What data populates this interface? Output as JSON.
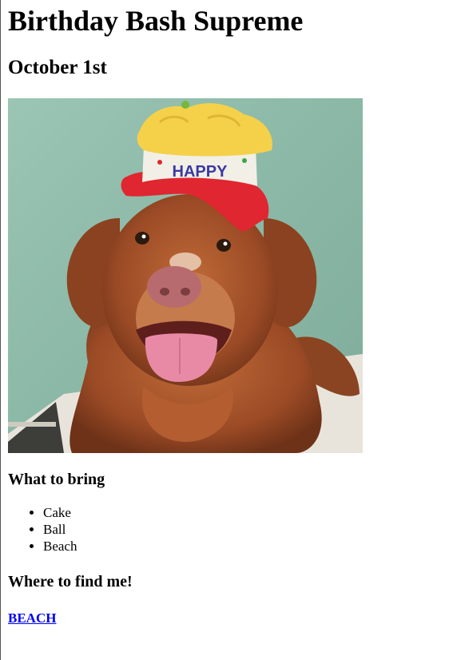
{
  "page": {
    "title": "Birthday Bash Supreme",
    "date": "October 1st"
  },
  "photo": {
    "hat_text": "HAPPY",
    "colors": {
      "wall": "#8fbcaa",
      "floor": "#e8e4dc",
      "fur": "#a5532b",
      "hat_brim": "#e02630",
      "hat_top": "#f5d14a",
      "tongue": "#e88aa5"
    }
  },
  "bring": {
    "heading": "What to bring",
    "items": [
      "Cake",
      "Ball",
      "Beach"
    ]
  },
  "location": {
    "heading": "Where to find me!",
    "link_label": "BEACH",
    "link_color": "#0000ee"
  }
}
